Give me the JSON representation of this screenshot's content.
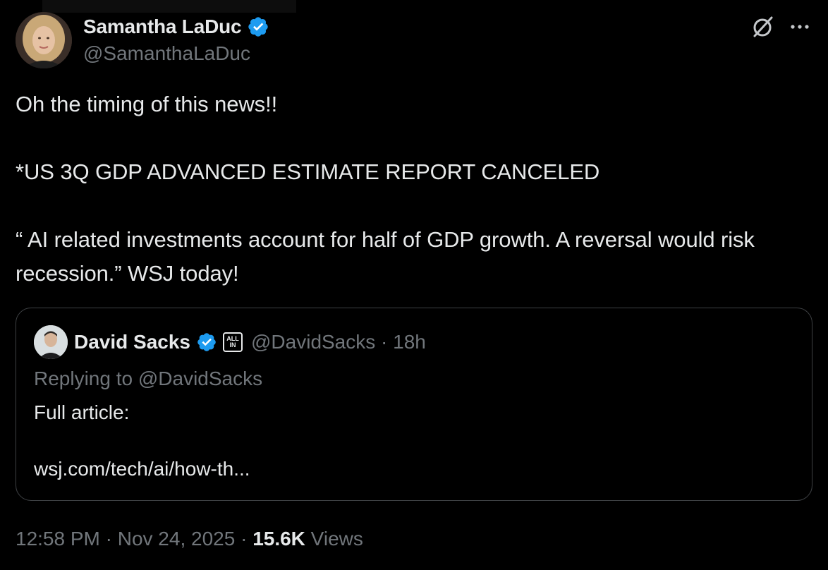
{
  "author": {
    "name": "Samantha LaDuc",
    "handle": "@SamanthaLaDuc",
    "verified": true
  },
  "header_icons": {
    "grok": "grok-icon",
    "more": "more-icon"
  },
  "tweet": {
    "lines": [
      "Oh the timing of this news!!",
      "*US 3Q GDP ADVANCED ESTIMATE REPORT CANCELED",
      "“ AI related investments account for half of GDP growth. A reversal would risk recession.” WSJ today!"
    ]
  },
  "quote": {
    "name": "David Sacks",
    "verified": true,
    "affiliate_badge_line1": "ALL",
    "affiliate_badge_line2": "IN",
    "handle_time": "@DavidSacks · 18h",
    "replying": "Replying to @DavidSacks",
    "body_line1": "Full article:",
    "body_line2": "wsj.com/tech/ai/how-th..."
  },
  "footer": {
    "time_date": "12:58 PM · Nov 24, 2025 · ",
    "views_count": "15.6K",
    "views_label": " Views"
  },
  "colors": {
    "background": "#000000",
    "text_primary": "#e7e9ea",
    "text_secondary": "#71767b",
    "verified_blue": "#1d9bf0",
    "border": "#3e4144"
  }
}
